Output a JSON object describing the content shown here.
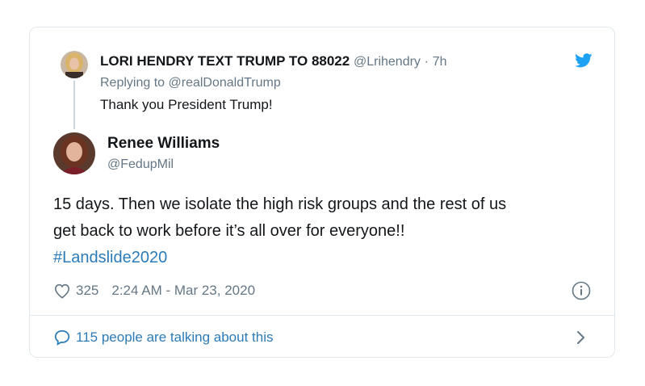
{
  "parent": {
    "name": "LORI HENDRY TEXT TRUMP TO 88022",
    "handle": "@Lrihendry",
    "dot": "·",
    "time": "7h",
    "replying_prefix": "Replying to ",
    "replying_to": "@realDonaldTrump",
    "text": "Thank you President Trump!"
  },
  "tweet": {
    "name": "Renee Williams",
    "handle": "@FedupMil",
    "text_line1": "15 days. Then we isolate the high risk groups and the rest of us",
    "text_line2": "get back to work before it’s all over for everyone!!",
    "hashtag": "#Landslide2020",
    "likes": "325",
    "timestamp": "2:24 AM - Mar 23, 2020"
  },
  "footer": {
    "talking": "115 people are talking about this"
  },
  "icons": {
    "brand": "twitter-bird-icon",
    "like": "heart-icon",
    "info": "info-icon",
    "conversation": "speech-bubble-icon",
    "open": "chevron-right-icon"
  },
  "colors": {
    "accent": "#2b7bb9",
    "twitter_blue": "#1da1f2",
    "secondary_text": "#657786",
    "primary_text": "#14171a",
    "border": "#e1e8ed"
  }
}
